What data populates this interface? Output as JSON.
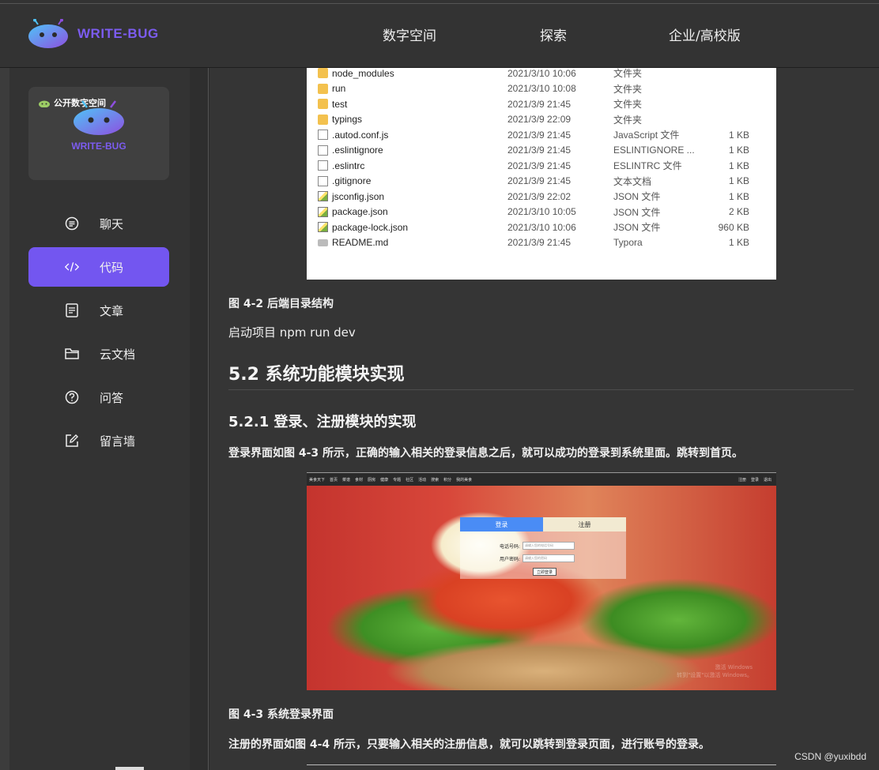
{
  "brand": {
    "name": "WRITE-BUG"
  },
  "nav": [
    "数字空间",
    "探索",
    "企业/高校版"
  ],
  "sidebar": {
    "card": {
      "tag": "公开数字空间",
      "brand": "WRITE-BUG"
    },
    "items": [
      {
        "label": "聊天",
        "icon": "chat-icon"
      },
      {
        "label": "代码",
        "icon": "code-icon",
        "active": true
      },
      {
        "label": "文章",
        "icon": "article-icon"
      },
      {
        "label": "云文档",
        "icon": "folder-icon"
      },
      {
        "label": "问答",
        "icon": "question-icon"
      },
      {
        "label": "留言墙",
        "icon": "edit-icon"
      }
    ]
  },
  "files": [
    {
      "name": "node_modules",
      "date": "2021/3/10 10:06",
      "type": "文件夹",
      "size": "",
      "kind": "folder"
    },
    {
      "name": "run",
      "date": "2021/3/10 10:08",
      "type": "文件夹",
      "size": "",
      "kind": "folder"
    },
    {
      "name": "test",
      "date": "2021/3/9 21:45",
      "type": "文件夹",
      "size": "",
      "kind": "folder"
    },
    {
      "name": "typings",
      "date": "2021/3/9 22:09",
      "type": "文件夹",
      "size": "",
      "kind": "folder"
    },
    {
      "name": ".autod.conf.js",
      "date": "2021/3/9 21:45",
      "type": "JavaScript 文件",
      "size": "1 KB",
      "kind": "js"
    },
    {
      "name": ".eslintignore",
      "date": "2021/3/9 21:45",
      "type": "ESLINTIGNORE ...",
      "size": "1 KB",
      "kind": "file"
    },
    {
      "name": ".eslintrc",
      "date": "2021/3/9 21:45",
      "type": "ESLINTRC 文件",
      "size": "1 KB",
      "kind": "file"
    },
    {
      "name": ".gitignore",
      "date": "2021/3/9 21:45",
      "type": "文本文档",
      "size": "1 KB",
      "kind": "file"
    },
    {
      "name": "jsconfig.json",
      "date": "2021/3/9 22:02",
      "type": "JSON 文件",
      "size": "1 KB",
      "kind": "json"
    },
    {
      "name": "package.json",
      "date": "2021/3/10 10:05",
      "type": "JSON 文件",
      "size": "2 KB",
      "kind": "json"
    },
    {
      "name": "package-lock.json",
      "date": "2021/3/10 10:06",
      "type": "JSON 文件",
      "size": "960 KB",
      "kind": "json"
    },
    {
      "name": "README.md",
      "date": "2021/3/9 21:45",
      "type": "Typora",
      "size": "1 KB",
      "kind": "md"
    }
  ],
  "article": {
    "caption1": "图 4-2 后端目录结构",
    "para1": "启动项目 npm run dev",
    "h2": "5.2 系统功能模块实现",
    "h3": "5.2.1 登录、注册模块的实现",
    "para2": "登录界面如图 4-3 所示，正确的输入相关的登录信息之后，就可以成功的登录到系统里面。跳转到首页。",
    "caption2": "图 4-3 系统登录界面",
    "para3": "注册的界面如图 4-4 所示，只要输入相关的注册信息，就可以跳转到登录页面，进行账号的登录。"
  },
  "login_shot": {
    "topnav": [
      "美食天下",
      "首页",
      "菜谱",
      "食材",
      "厨房",
      "健康",
      "专题",
      "社区",
      "活动",
      "搜索",
      "积分",
      "我的美食"
    ],
    "topnav_right": [
      "注册",
      "登录",
      "退出"
    ],
    "tab_login": "登录",
    "tab_register": "注册",
    "phone_label": "电话号码:",
    "phone_placeholder": "请输入您的电话号码",
    "password_label": "用户密码:",
    "password_placeholder": "请输入您的密码",
    "submit": "立即登录",
    "watermark_line1": "激活 Windows",
    "watermark_line2": "转到\"设置\"以激活 Windows。"
  },
  "watermark": "CSDN @yuxibdd"
}
